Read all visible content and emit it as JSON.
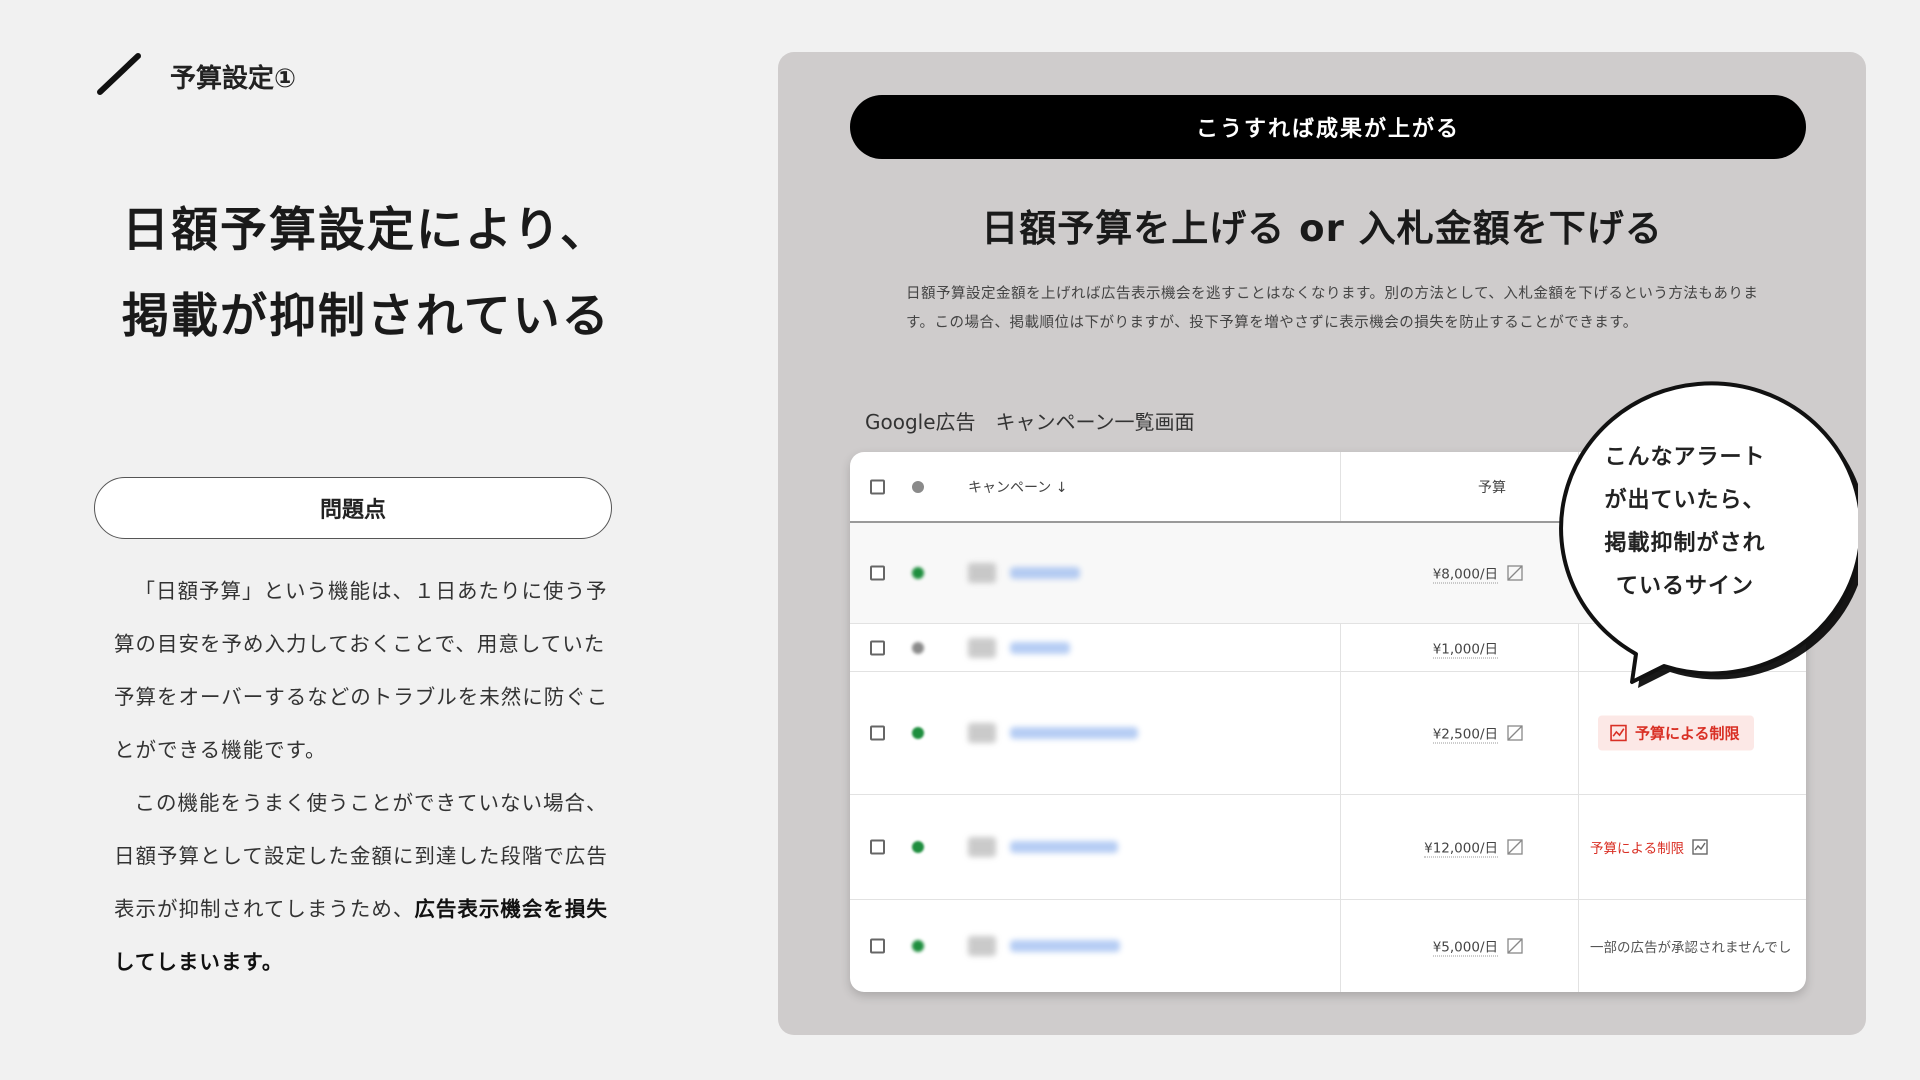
{
  "header": {
    "section_title": "予算設定①"
  },
  "left": {
    "headline_line1": "日額予算設定により、",
    "headline_line2": "掲載が抑制されている",
    "problem_label": "問題点",
    "para1": "「日額予算」という機能は、１日あたりに使う予算の目安を予め入力しておくことで、用意していた予算をオーバーするなどのトラブルを未然に防ぐことができる機能です。",
    "para2_plain": "この機能をうまく使うことができていない場合、日額予算として設定した金額に到達した段階で広告表示が抑制されてしまうため、",
    "para2_bold": "広告表示機会を損失してしまいます。"
  },
  "right": {
    "banner": "こうすれば成果が上がる",
    "headline": "日額予算を上げる or 入札金額を下げる",
    "description": "日額予算設定金額を上げれば広告表示機会を逃すことはなくなります。別の方法として、入札金額を下げるという方法もあります。この場合、掲載順位は下がりますが、投下予算を増やさずに表示機会の損失を防止することができます。",
    "screen_label": "Google広告　キャンペーン一覧画面",
    "bubble_lines": [
      "こんなアラート",
      "が出ていたら、",
      "掲載抑制がされ",
      "ているサイン"
    ]
  },
  "table": {
    "col_campaign": "キャンペーン ↓",
    "col_budget": "予算",
    "rows": [
      {
        "budget": "¥8,000/日",
        "status": ""
      },
      {
        "budget": "¥1,000/日",
        "status": ""
      },
      {
        "budget": "¥2,500/日",
        "status": "予算による制限"
      },
      {
        "budget": "¥12,000/日",
        "status": "予算による制限"
      },
      {
        "budget": "¥5,000/日",
        "status": "一部の広告が承認されませんでし"
      }
    ]
  },
  "colors": {
    "panel_bg": "#cfcccc",
    "status_red": "#d93025",
    "status_chip_bg": "#fce8e6",
    "enabled_green": "#1e8e3e"
  }
}
